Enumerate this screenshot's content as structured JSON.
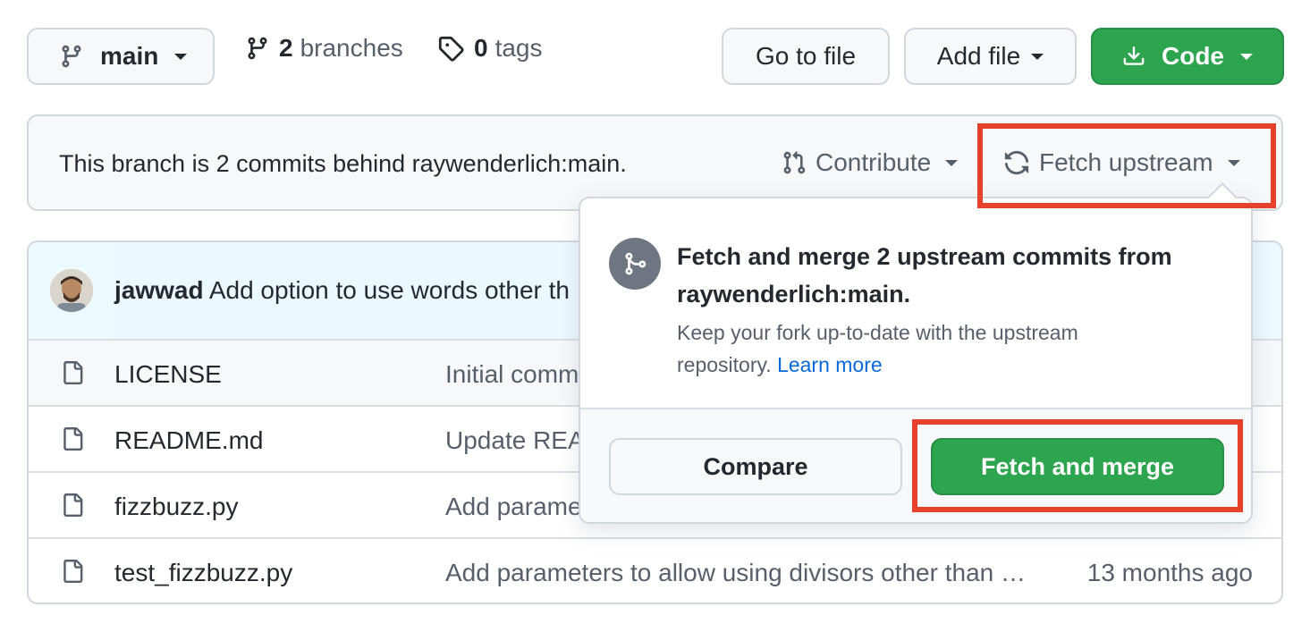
{
  "toolbar": {
    "branch_button": "main",
    "branches_count": "2",
    "branches_label": "branches",
    "tags_count": "0",
    "tags_label": "tags",
    "go_to_file": "Go to file",
    "add_file": "Add file",
    "code": "Code"
  },
  "banner": {
    "text": "This branch is 2 commits behind raywenderlich:main.",
    "contribute": "Contribute",
    "fetch_upstream": "Fetch upstream"
  },
  "latest_commit": {
    "author": "jawwad",
    "message": "Add option to use words other th"
  },
  "files": [
    {
      "name": "LICENSE",
      "message": "Initial comm",
      "age": ""
    },
    {
      "name": "README.md",
      "message": "Update REA",
      "age": ""
    },
    {
      "name": "fizzbuzz.py",
      "message": "Add parame",
      "age": ""
    },
    {
      "name": "test_fizzbuzz.py",
      "message": "Add parameters to allow using divisors other than …",
      "age": "13 months ago"
    }
  ],
  "popover": {
    "title_line1": "Fetch and merge 2 upstream commits from",
    "title_line2": "raywenderlich:main.",
    "desc_line1": "Keep your fork up-to-date with the upstream",
    "desc_line2": "repository.",
    "learn_more": "Learn more",
    "compare": "Compare",
    "fetch_and_merge": "Fetch and merge"
  },
  "colors": {
    "primary_green": "#2da44e",
    "highlight_red": "#e8412b",
    "link_blue": "#0969da"
  }
}
